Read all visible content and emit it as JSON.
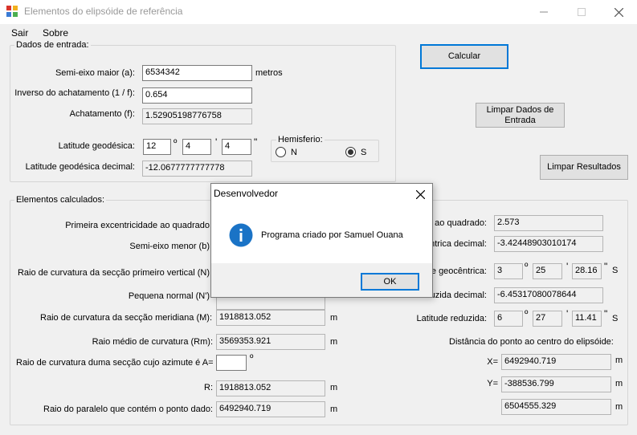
{
  "window": {
    "title": "Elementos do elipsóide de referência"
  },
  "menu": {
    "items": [
      "Sair",
      "Sobre"
    ]
  },
  "input_group": {
    "label": "Dados de entrada:",
    "semi_major_label": "Semi-eixo maior (a):",
    "semi_major_value": "6534342",
    "semi_major_unit": "metros",
    "inv_flattening_label": "Inverso do achatamento (1 / f):",
    "inv_flattening_value": "0.654",
    "flattening_label": "Achatamento (f):",
    "flattening_value": "1.52905198776758",
    "latitude_label": "Latitude geodésica:",
    "lat_deg": "12",
    "lat_min": "4",
    "lat_sec": "4",
    "deg_symbol": "º",
    "min_symbol": "'",
    "sec_symbol": "\"",
    "latitude_decimal_label": "Latitude geodésica decimal:",
    "latitude_decimal_value": "-12.0677777777778",
    "hemisphere_label": "Hemisferio:",
    "hemisphere_n": "N",
    "hemisphere_s": "S",
    "hemisphere_selected": "S"
  },
  "buttons": {
    "calcular": "Calcular",
    "limpar_dados": "Limpar Dados de Entrada",
    "limpar_resultados": "Limpar Resultados"
  },
  "results_group": {
    "label": "Elementos calculados:",
    "first_ecc_label": "Primeira excentricidade ao quadrado",
    "semi_minor_label": "Semi-eixo menor (b)",
    "prime_vertical_label": "Raio de curvatura da secção primeiro vertical (N)",
    "small_normal_label": "Pequena normal (N')",
    "meridian_label": "Raio de curvatura da secção meridiana (M):",
    "meridian_value": "1918813.052",
    "mean_radius_label": "Raio médio de curvatura (Rm):",
    "mean_radius_value": "3569353.921",
    "azimuth_label": "Raio de curvatura duma secção cujo azimute é A=",
    "azimuth_value": "",
    "r_label": "R:",
    "r_value": "1918813.052",
    "parallel_label": "Raio do paralelo que contém o ponto dado:",
    "parallel_value": "6492940.719",
    "unit_m": "m",
    "second_ecc_label": "ao quadrado:",
    "second_ecc_value": "2.573",
    "geocentric_dec_label": "ntrica decimal:",
    "geocentric_dec_value": "-3.42448903010174",
    "geocentric_label": "e geocêntrica:",
    "geo_deg": "3",
    "geo_min": "25",
    "geo_sec": "28.16",
    "geo_hemi": "S",
    "reduced_dec_label": "uzida decimal:",
    "reduced_dec_value": "-6.45317080078644",
    "reduced_label": "Latitude reduzida:",
    "red_deg": "6",
    "red_min": "27",
    "red_sec": "11.41",
    "red_hemi": "S",
    "distance_label": "Distância do ponto ao centro do elipsóide:",
    "x_label": "X=",
    "x_value": "6492940.719",
    "y_label": "Y=",
    "y_value": "-388536.799",
    "d_value": "6504555.329"
  },
  "dialog": {
    "title": "Desenvolvedor",
    "message": "Programa criado por Samuel Ouana",
    "ok": "OK"
  }
}
